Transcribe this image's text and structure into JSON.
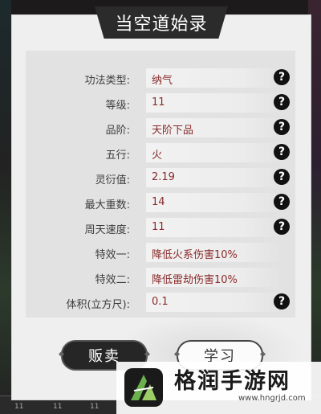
{
  "title": "当空道始录",
  "attributes": [
    {
      "label": "功法类型:",
      "value": "纳气",
      "help": "?"
    },
    {
      "label": "等级:",
      "value": "11",
      "help": "?"
    },
    {
      "label": "品阶:",
      "value": "天阶下品",
      "help": "?"
    },
    {
      "label": "五行:",
      "value": "火",
      "help": "?"
    },
    {
      "label": "灵衍值:",
      "value": "2.19",
      "help": "?"
    },
    {
      "label": "最大重数:",
      "value": "14",
      "help": "?"
    },
    {
      "label": "周天速度:",
      "value": "11",
      "help": "?"
    },
    {
      "label": "特效一:",
      "value": "降低火系伤害10%"
    },
    {
      "label": "特效二:",
      "value": "降低雷劫伤害10%"
    },
    {
      "label": "体积(立方尺):",
      "value": "0.1",
      "help": "?"
    }
  ],
  "buttons": {
    "sell": "贩卖",
    "learn": "学习"
  },
  "watermark": {
    "title": "格润手游网",
    "url": "www.hngrjd.com"
  },
  "bottom_bar": {
    "slot_numbers": [
      "11",
      "11",
      "11"
    ]
  },
  "colors": {
    "value_text": "#8a2b2b",
    "title_bar": "#2b2b2b",
    "panel": "#efefef"
  }
}
